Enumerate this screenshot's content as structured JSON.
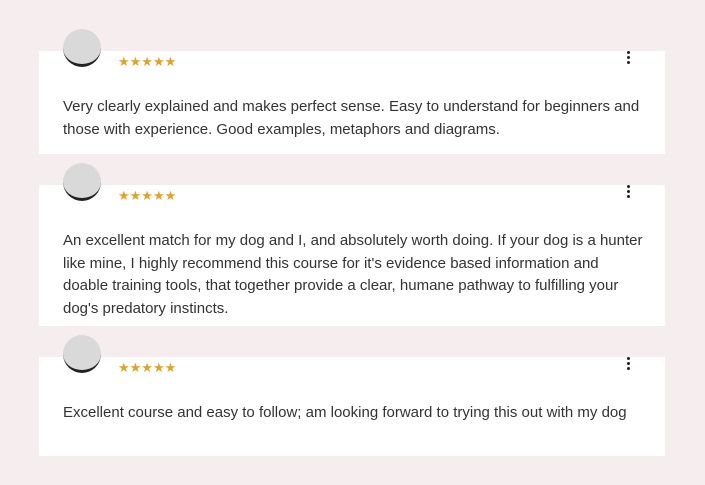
{
  "colors": {
    "background": "#f6eeee",
    "card": "#ffffff",
    "star": "#e5a21e",
    "avatar": "#d9d9d9",
    "text": "#333333"
  },
  "reviews": [
    {
      "rating": 5,
      "stars": "★★★★★",
      "menu_icon": "more-vertical-icon",
      "text": "Very clearly explained and makes perfect sense. Easy to understand for beginners and those with experience. Good examples, metaphors and diagrams."
    },
    {
      "rating": 5,
      "stars": "★★★★★",
      "menu_icon": "more-vertical-icon",
      "text": "An excellent match for my dog and I, and absolutely worth doing. If your dog is a hunter like mine, I highly recommend this course for it's evidence based information and doable training tools, that together provide a clear, humane pathway to fulfilling your dog's predatory instincts."
    },
    {
      "rating": 5,
      "stars": "★★★★★",
      "menu_icon": "more-vertical-icon",
      "text": "Excellent course and easy to follow; am looking forward to trying this out with my dog"
    }
  ]
}
